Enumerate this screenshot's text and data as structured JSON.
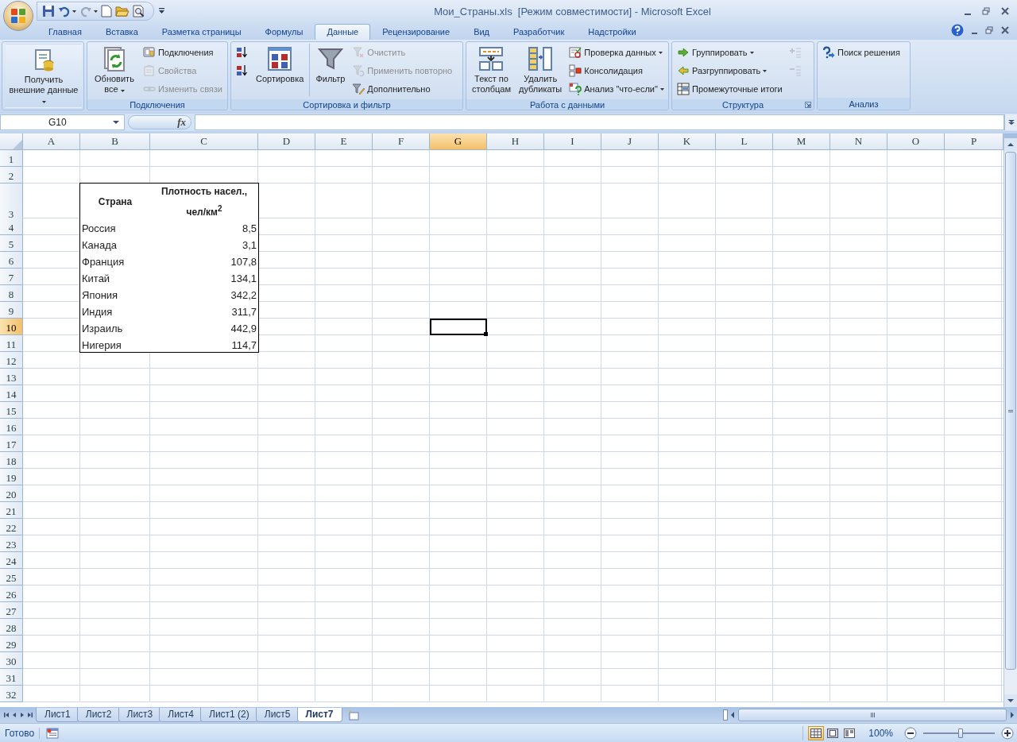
{
  "window": {
    "title": "Мои_Страны.xls  [Режим совместимости] - Microsoft Excel"
  },
  "ribbon": {
    "tabs": [
      {
        "label": "Главная",
        "selected": false
      },
      {
        "label": "Вставка",
        "selected": false
      },
      {
        "label": "Разметка страницы",
        "selected": false
      },
      {
        "label": "Формулы",
        "selected": false
      },
      {
        "label": "Данные",
        "selected": true
      },
      {
        "label": "Рецензирование",
        "selected": false
      },
      {
        "label": "Вид",
        "selected": false
      },
      {
        "label": "Разработчик",
        "selected": false
      },
      {
        "label": "Надстройки",
        "selected": false
      }
    ],
    "groups": [
      {
        "columns": [
          [
            {
              "kind": "large",
              "label": "Получить внешние данные",
              "dropdown": true,
              "disabled": false
            }
          ]
        ]
      },
      {
        "label": "Подключения",
        "launcher": false,
        "columns": [
          [
            {
              "kind": "large",
              "label": "Обновить все",
              "dropdown": true,
              "disabled": false
            }
          ],
          [
            {
              "kind": "small",
              "label": "Подключения",
              "dropdown": false,
              "disabled": false
            },
            {
              "kind": "small",
              "label": "Свойства",
              "dropdown": false,
              "disabled": true
            },
            {
              "kind": "small",
              "label": "Изменить связи",
              "dropdown": false,
              "disabled": true
            }
          ]
        ]
      },
      {
        "label": "Сортировка и фильтр",
        "launcher": false,
        "columns": [
          [
            {
              "kind": "icon",
              "disabled": false
            },
            {
              "kind": "icon",
              "disabled": false
            }
          ],
          [
            {
              "kind": "large",
              "label": "Сортировка",
              "dropdown": false,
              "disabled": false
            }
          ],
          [
            {
              "kind": "large",
              "label": "Фильтр",
              "dropdown": false,
              "disabled": false
            }
          ],
          [
            {
              "kind": "small",
              "label": "Очистить",
              "dropdown": false,
              "disabled": true
            },
            {
              "kind": "small",
              "label": "Применить повторно",
              "dropdown": false,
              "disabled": true
            },
            {
              "kind": "small",
              "label": "Дополнительно",
              "dropdown": false,
              "disabled": false
            }
          ]
        ]
      },
      {
        "label": "Работа с данными",
        "launcher": false,
        "columns": [
          [
            {
              "kind": "large",
              "label": "Текст по столбцам",
              "dropdown": false,
              "disabled": false
            }
          ],
          [
            {
              "kind": "large",
              "label": "Удалить дубликаты",
              "dropdown": false,
              "disabled": false
            }
          ],
          [
            {
              "kind": "small",
              "label": "Проверка данных",
              "dropdown": true,
              "disabled": false
            },
            {
              "kind": "small",
              "label": "Консолидация",
              "dropdown": false,
              "disabled": false
            },
            {
              "kind": "small",
              "label": "Анализ \"что-если\"",
              "dropdown": true,
              "disabled": false
            }
          ]
        ]
      },
      {
        "label": "Структура",
        "launcher": true,
        "columns": [
          [
            {
              "kind": "small",
              "label": "Группировать",
              "dropdown": true,
              "disabled": false
            },
            {
              "kind": "small",
              "label": "Разгруппировать",
              "dropdown": true,
              "disabled": false
            },
            {
              "kind": "small",
              "label": "Промежуточные итоги",
              "dropdown": false,
              "disabled": false
            }
          ],
          [
            {
              "kind": "icon",
              "disabled": true
            },
            {
              "kind": "icon",
              "disabled": true
            }
          ]
        ]
      },
      {
        "label": "Анализ",
        "launcher": false,
        "columns": [
          [
            {
              "kind": "small",
              "label": "Поиск решения",
              "dropdown": false,
              "disabled": false
            }
          ]
        ]
      }
    ]
  },
  "formula_bar": {
    "name_box": "G10",
    "function_button": "fx"
  },
  "sheet": {
    "columns": [
      {
        "label": "A",
        "selected": false
      },
      {
        "label": "B",
        "selected": false
      },
      {
        "label": "C",
        "selected": false
      },
      {
        "label": "D",
        "selected": false
      },
      {
        "label": "E",
        "selected": false
      },
      {
        "label": "F",
        "selected": false
      },
      {
        "label": "G",
        "selected": true
      },
      {
        "label": "H",
        "selected": false
      },
      {
        "label": "I",
        "selected": false
      },
      {
        "label": "J",
        "selected": false
      },
      {
        "label": "K",
        "selected": false
      },
      {
        "label": "L",
        "selected": false
      },
      {
        "label": "M",
        "selected": false
      },
      {
        "label": "N",
        "selected": false
      },
      {
        "label": "O",
        "selected": false
      },
      {
        "label": "P",
        "selected": false
      }
    ],
    "rows": [
      {
        "label": "1",
        "selected": false
      },
      {
        "label": "2",
        "selected": false
      },
      {
        "label": "3",
        "selected": false
      },
      {
        "label": "4",
        "selected": false
      },
      {
        "label": "5",
        "selected": false
      },
      {
        "label": "6",
        "selected": false
      },
      {
        "label": "7",
        "selected": false
      },
      {
        "label": "8",
        "selected": false
      },
      {
        "label": "9",
        "selected": false
      },
      {
        "label": "10",
        "selected": true
      },
      {
        "label": "11",
        "selected": false
      },
      {
        "label": "12",
        "selected": false
      },
      {
        "label": "13",
        "selected": false
      },
      {
        "label": "14",
        "selected": false
      },
      {
        "label": "15",
        "selected": false
      },
      {
        "label": "16",
        "selected": false
      },
      {
        "label": "17",
        "selected": false
      },
      {
        "label": "18",
        "selected": false
      },
      {
        "label": "19",
        "selected": false
      },
      {
        "label": "20",
        "selected": false
      },
      {
        "label": "21",
        "selected": false
      },
      {
        "label": "22",
        "selected": false
      },
      {
        "label": "23",
        "selected": false
      },
      {
        "label": "24",
        "selected": false
      },
      {
        "label": "25",
        "selected": false
      },
      {
        "label": "26",
        "selected": false
      },
      {
        "label": "27",
        "selected": false
      },
      {
        "label": "28",
        "selected": false
      },
      {
        "label": "29",
        "selected": false
      },
      {
        "label": "30",
        "selected": false
      },
      {
        "label": "31",
        "selected": false
      },
      {
        "label": "32",
        "selected": false
      }
    ],
    "table": {
      "header": [
        "Страна",
        "Плотность насел., чел/км$^{2}$"
      ],
      "rows": [
        [
          "Россия",
          "8,5"
        ],
        [
          "Канада",
          "3,1"
        ],
        [
          "Франция",
          "107,8"
        ],
        [
          "Китай",
          "134,1"
        ],
        [
          "Япония",
          "342,2"
        ],
        [
          "Индия",
          "311,7"
        ],
        [
          "Израиль",
          "442,9"
        ],
        [
          "Нигерия",
          "114,7"
        ]
      ]
    }
  },
  "sheet_tabs": [
    {
      "label": "Лист1",
      "selected": false
    },
    {
      "label": "Лист2",
      "selected": false
    },
    {
      "label": "Лист3",
      "selected": false
    },
    {
      "label": "Лист4",
      "selected": false
    },
    {
      "label": "Лист1 (2)",
      "selected": false
    },
    {
      "label": "Лист5",
      "selected": false
    },
    {
      "label": "Лист7",
      "selected": true
    }
  ],
  "status_bar": {
    "status": "Готово",
    "view_buttons": [
      {
        "selected": true
      },
      {
        "selected": false
      },
      {
        "selected": false
      }
    ],
    "zoom": "100%",
    "zoom_slider": {
      "level": 0.52
    }
  }
}
